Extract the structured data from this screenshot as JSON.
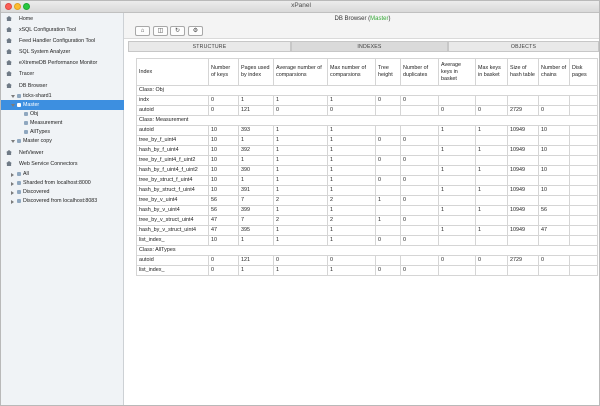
{
  "window": {
    "title": "xPanel"
  },
  "sidebar": {
    "items": [
      {
        "label": "Home",
        "icon": "home-icon",
        "depth": 0,
        "kind": "house"
      },
      {
        "label": "xSQL Configuration Tool",
        "icon": "home-icon",
        "depth": 0,
        "kind": "house"
      },
      {
        "label": "Feed Handler Configuration Tool",
        "icon": "home-icon",
        "depth": 0,
        "kind": "house"
      },
      {
        "label": "SQL System Analyzer",
        "icon": "home-icon",
        "depth": 0,
        "kind": "house"
      },
      {
        "label": "eXtremeDB Performance Monitor",
        "icon": "home-icon",
        "depth": 0,
        "kind": "house"
      },
      {
        "label": "Tracer",
        "icon": "home-icon",
        "depth": 0,
        "kind": "house"
      },
      {
        "label": "DB Browser",
        "icon": "home-icon",
        "depth": 0,
        "kind": "house"
      },
      {
        "label": "ticks-shard1",
        "icon": "database-icon",
        "depth": 1,
        "kind": "open"
      },
      {
        "label": "Master",
        "icon": "database-icon",
        "depth": 1,
        "kind": "open",
        "selected": true
      },
      {
        "label": "Obj",
        "icon": "class-icon",
        "depth": 2,
        "kind": "leaf"
      },
      {
        "label": "Measurement",
        "icon": "class-icon",
        "depth": 2,
        "kind": "leaf"
      },
      {
        "label": "AllTypes",
        "icon": "class-icon",
        "depth": 2,
        "kind": "leaf"
      },
      {
        "label": "Master copy",
        "icon": "database-icon",
        "depth": 1,
        "kind": "open"
      },
      {
        "label": "NetViewer",
        "icon": "home-icon",
        "depth": 0,
        "kind": "house"
      },
      {
        "label": "Web Service Connectors",
        "icon": "home-icon",
        "depth": 0,
        "kind": "house"
      },
      {
        "label": "All",
        "icon": "folder-icon",
        "depth": 1,
        "kind": "closed"
      },
      {
        "label": "Sharded from localhost:8000",
        "icon": "folder-icon",
        "depth": 1,
        "kind": "closed"
      },
      {
        "label": "Discovered",
        "icon": "folder-icon",
        "depth": 1,
        "kind": "closed"
      },
      {
        "label": "Discovered from localhost:8083",
        "icon": "folder-icon",
        "depth": 1,
        "kind": "closed"
      }
    ]
  },
  "header": {
    "title_prefix": "DB Browser (",
    "title_master": "Master",
    "title_suffix": ")"
  },
  "toolbar": {
    "buttons": [
      {
        "name": "home-button",
        "icon": "home-icon",
        "glyph": "⌂"
      },
      {
        "name": "split-button",
        "icon": "split-view-icon",
        "glyph": "◫"
      },
      {
        "name": "refresh-button",
        "icon": "refresh-icon",
        "glyph": "↻"
      },
      {
        "name": "settings-button",
        "icon": "gear-icon",
        "glyph": "⚙"
      }
    ]
  },
  "tabs": [
    {
      "label": "STRUCTURE",
      "active": false
    },
    {
      "label": "INDEXES",
      "active": true
    },
    {
      "label": "OBJECTS",
      "active": false
    }
  ],
  "table": {
    "columns": [
      "Index",
      "Number of keys",
      "Pages used by index",
      "Average number of comparsions",
      "Max number of comparsions",
      "Tree height",
      "Number of duplicates",
      "Average keys in basket",
      "Max keys in basket",
      "Size of hash table",
      "Number of chains",
      "Disk pages"
    ],
    "rows": [
      {
        "type": "class",
        "label": "Class: Obj"
      },
      {
        "type": "data",
        "cells": [
          "indx",
          "0",
          "1",
          "1",
          "1",
          "0",
          "0",
          "",
          "",
          "",
          "",
          ""
        ]
      },
      {
        "type": "data",
        "cells": [
          "autoid",
          "0",
          "121",
          "0",
          "0",
          "",
          "",
          "0",
          "0",
          "2729",
          "0",
          ""
        ]
      },
      {
        "type": "class",
        "label": "Class: Measurement"
      },
      {
        "type": "data",
        "cells": [
          "autoid",
          "10",
          "393",
          "1",
          "1",
          "",
          "",
          "1",
          "1",
          "10949",
          "10",
          ""
        ]
      },
      {
        "type": "data",
        "cells": [
          "tree_by_f_uint4",
          "10",
          "1",
          "1",
          "1",
          "0",
          "0",
          "",
          "",
          "",
          "",
          ""
        ]
      },
      {
        "type": "data",
        "cells": [
          "hash_by_f_uint4",
          "10",
          "392",
          "1",
          "1",
          "",
          "",
          "1",
          "1",
          "10949",
          "10",
          ""
        ]
      },
      {
        "type": "data",
        "cells": [
          "tree_by_f_uint4_f_uint2",
          "10",
          "1",
          "1",
          "1",
          "0",
          "0",
          "",
          "",
          "",
          "",
          ""
        ]
      },
      {
        "type": "data",
        "cells": [
          "hash_by_f_uint4_f_uint2",
          "10",
          "390",
          "1",
          "1",
          "",
          "",
          "1",
          "1",
          "10949",
          "10",
          ""
        ]
      },
      {
        "type": "data",
        "cells": [
          "tree_by_struct_f_uint4",
          "10",
          "1",
          "1",
          "1",
          "0",
          "0",
          "",
          "",
          "",
          "",
          ""
        ]
      },
      {
        "type": "data",
        "cells": [
          "hash_by_struct_f_uint4",
          "10",
          "391",
          "1",
          "1",
          "",
          "",
          "1",
          "1",
          "10949",
          "10",
          ""
        ]
      },
      {
        "type": "data",
        "cells": [
          "tree_by_v_uint4",
          "56",
          "7",
          "2",
          "2",
          "1",
          "0",
          "",
          "",
          "",
          "",
          ""
        ]
      },
      {
        "type": "data",
        "cells": [
          "hash_by_v_uint4",
          "56",
          "399",
          "1",
          "1",
          "",
          "",
          "1",
          "1",
          "10949",
          "56",
          ""
        ]
      },
      {
        "type": "data",
        "cells": [
          "tree_by_v_struct_uint4",
          "47",
          "7",
          "2",
          "2",
          "1",
          "0",
          "",
          "",
          "",
          "",
          ""
        ]
      },
      {
        "type": "data",
        "cells": [
          "hash_by_v_struct_uint4",
          "47",
          "395",
          "1",
          "1",
          "",
          "",
          "1",
          "1",
          "10949",
          "47",
          ""
        ]
      },
      {
        "type": "data",
        "cells": [
          "list_index_",
          "10",
          "1",
          "1",
          "1",
          "0",
          "0",
          "",
          "",
          "",
          "",
          ""
        ]
      },
      {
        "type": "class",
        "label": "Class: AllTypes"
      },
      {
        "type": "data",
        "cells": [
          "autoid",
          "0",
          "121",
          "0",
          "0",
          "",
          "",
          "0",
          "0",
          "2729",
          "0",
          ""
        ]
      },
      {
        "type": "data",
        "cells": [
          "list_index_",
          "0",
          "1",
          "1",
          "1",
          "0",
          "0",
          "",
          "",
          "",
          "",
          ""
        ]
      }
    ]
  }
}
